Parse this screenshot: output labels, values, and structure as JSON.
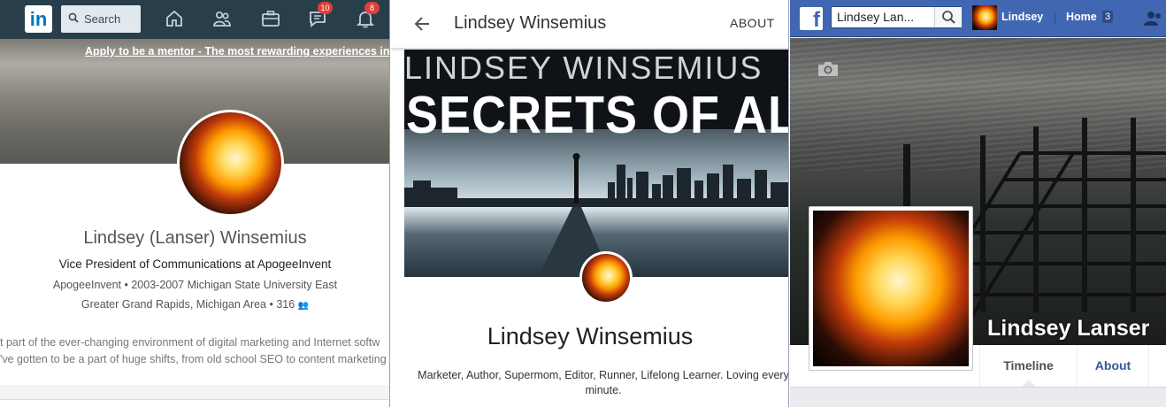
{
  "linkedin": {
    "logo": "in",
    "search_placeholder": "Search",
    "nav_icons": [
      "home-icon",
      "network-icon",
      "jobs-icon",
      "messaging-icon",
      "notifications-icon"
    ],
    "messages_badge": "10",
    "notifications_badge": "8",
    "mentor_link": "Apply to be a mentor - The most rewarding experiences invo",
    "profile_name": "Lindsey (Lanser) Winsemius",
    "headline": "Vice President of Communications at ApogeeInvent",
    "meta": "ApogeeInvent • 2003-2007 Michigan State University East",
    "location": "Greater Grand Rapids, Michigan Area • 316",
    "summary_line1": "t part of the ever-changing environment of digital marketing and Internet softw",
    "summary_line2": "'ve gotten to be a part of huge shifts, from old school SEO to content marketing",
    "brand_color": "#0077b5",
    "bar_color": "#283e4a"
  },
  "gplus": {
    "header_title": "Lindsey Winsemius",
    "about_tab": "ABOUT",
    "cover_top_text": "LINDSEY WINSEMIUS",
    "cover_main_text": "SECRETS OF ALBA",
    "profile_name": "Lindsey Winsemius",
    "tagline": "Marketer, Author, Supermom, Editor, Runner, Lifelong Learner. Loving every minute."
  },
  "facebook": {
    "logo": "f",
    "search_value": "Lindsey Lan...",
    "user_name": "Lindsey",
    "home_label": "Home",
    "home_count": "3",
    "profile_name": "Lindsey Lanser Winsemius",
    "tabs": {
      "timeline": "Timeline",
      "about": "About"
    },
    "brand_color": "#4267b2"
  }
}
